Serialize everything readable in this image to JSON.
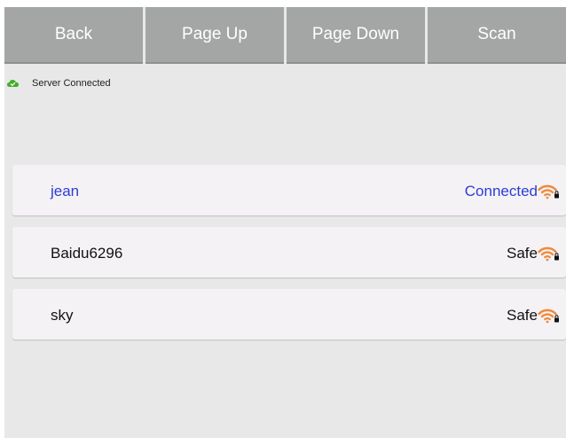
{
  "toolbar": {
    "buttons": [
      {
        "label": "Back"
      },
      {
        "label": "Page Up"
      },
      {
        "label": "Page Down"
      },
      {
        "label": "Scan"
      }
    ]
  },
  "status": {
    "icon": "cloud-check-icon",
    "text": "Server Connected",
    "color": "#3fae2a"
  },
  "networks": [
    {
      "ssid": "jean",
      "state": "Connected",
      "icon": "wifi-lock-icon",
      "highlight": true
    },
    {
      "ssid": "Baidu6296",
      "state": "Safe",
      "icon": "wifi-lock-icon",
      "highlight": false
    },
    {
      "ssid": "sky",
      "state": "Safe",
      "icon": "wifi-lock-icon",
      "highlight": false
    }
  ],
  "colors": {
    "toolbar_button": "#a3a6a5",
    "connected_text": "#2b3dd6",
    "wifi_icon": "#f08a3c",
    "background": "#e8e8e8"
  }
}
